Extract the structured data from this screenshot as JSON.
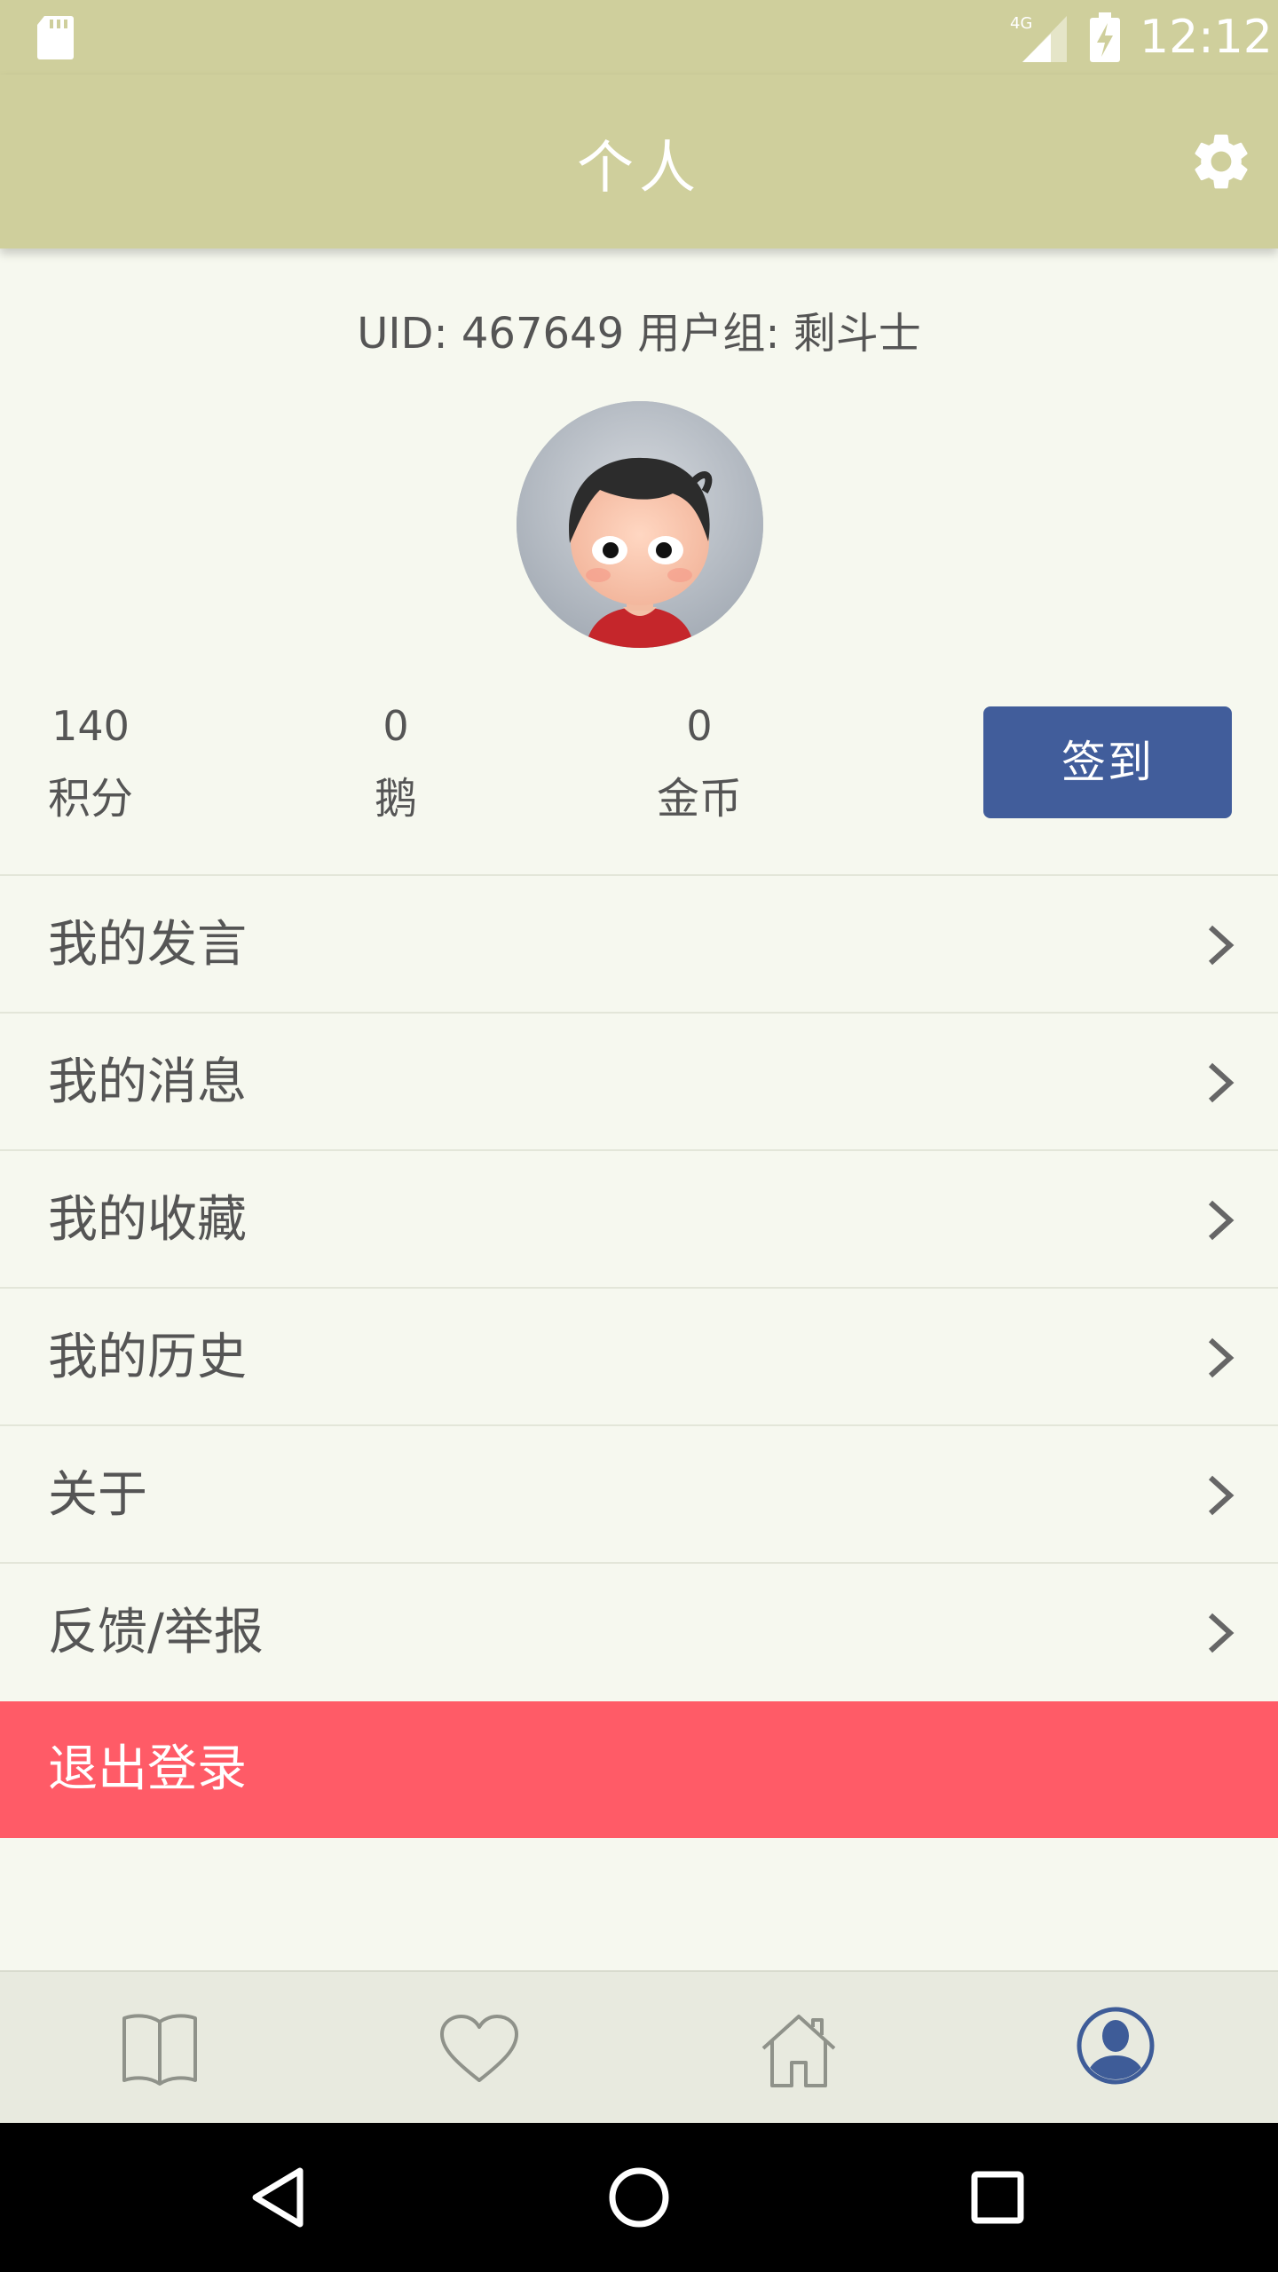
{
  "status_bar": {
    "network": "4G",
    "time": "12:12"
  },
  "app_bar": {
    "title": "个人",
    "settings_icon": "gear-icon"
  },
  "profile": {
    "uid_line": "UID: 467649 用户组: 剩斗士",
    "avatar": "avatar-cartoon-boy"
  },
  "stats": [
    {
      "value": "140",
      "label": "积分"
    },
    {
      "value": "0",
      "label": "鹅"
    },
    {
      "value": "0",
      "label": "金币"
    }
  ],
  "checkin_label": "签到",
  "menu": {
    "items": [
      {
        "label": "我的发言"
      },
      {
        "label": "我的消息"
      },
      {
        "label": "我的收藏"
      },
      {
        "label": "我的历史"
      },
      {
        "label": "关于"
      },
      {
        "label": "反馈/举报"
      }
    ],
    "logout_label": "退出登录"
  },
  "bottom_nav": {
    "tabs": [
      {
        "icon": "book-icon",
        "active": false
      },
      {
        "icon": "heart-icon",
        "active": false
      },
      {
        "icon": "home-icon",
        "active": false
      },
      {
        "icon": "profile-icon",
        "active": true
      }
    ]
  },
  "colors": {
    "header": "#cfcf9c",
    "background": "#f6f8ef",
    "checkin_button": "#415d9b",
    "logout": "#ff5b67",
    "active_tab": "#3e5c98"
  }
}
